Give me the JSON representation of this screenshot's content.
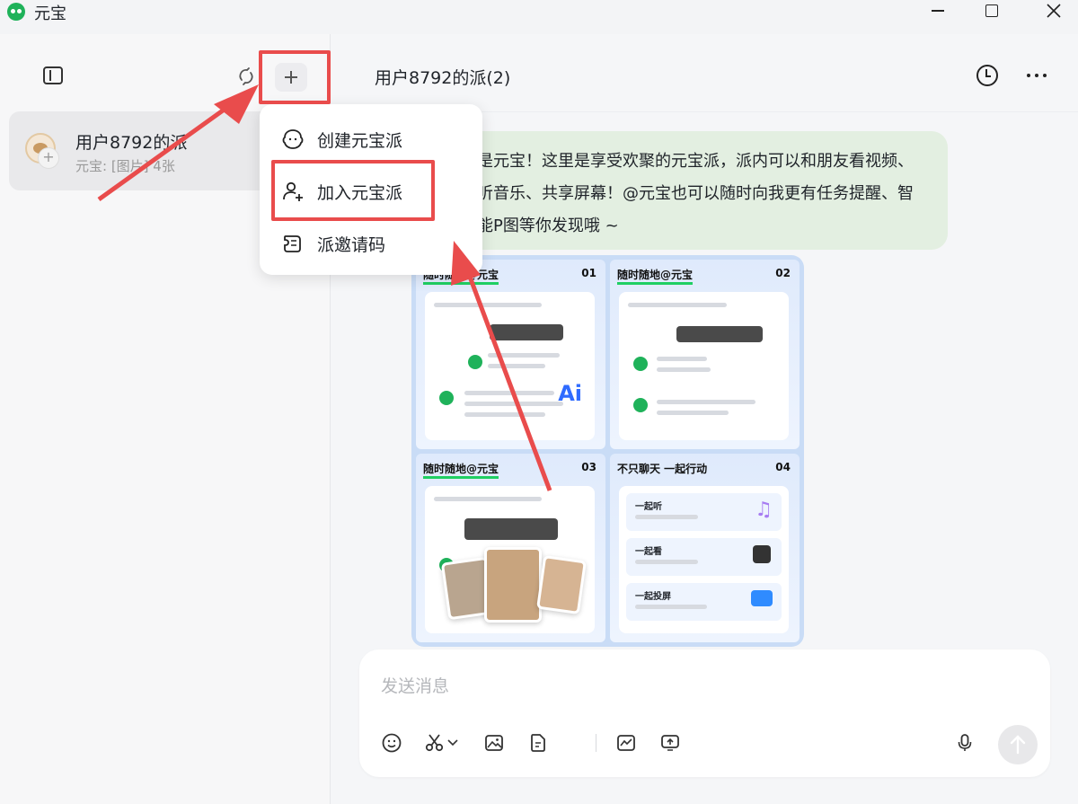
{
  "window": {
    "title": "元宝"
  },
  "sidebar": {
    "conversation": {
      "title": "用户8792的派",
      "subtitle": "元宝: [图片] 4张",
      "avatar_badge": "+"
    }
  },
  "chat": {
    "title": "用户8792的派(2)",
    "message": "是元宝！这里是享受欢聚的元宝派，派内可以和朋友看视频、听音乐、共享屏幕！@元宝也可以随时向我更有任务提醒、智能P图等你发现哦 ~",
    "image_cards": [
      {
        "title": "随时随地@元宝",
        "index": "01"
      },
      {
        "title": "随时随地@元宝",
        "index": "02"
      },
      {
        "title": "随时随地@元宝",
        "index": "03"
      },
      {
        "title": "不只聊天 一起行动",
        "index": "04"
      }
    ],
    "card4_rows": [
      "一起听",
      "一起看",
      "一起投屏"
    ],
    "card1_ai": "Ai"
  },
  "composer": {
    "placeholder": "发送消息"
  },
  "menu": {
    "items": [
      {
        "label": "创建元宝派",
        "icon": "create-group-icon"
      },
      {
        "label": "加入元宝派",
        "icon": "join-group-icon"
      },
      {
        "label": "派邀请码",
        "icon": "invite-code-icon"
      }
    ]
  },
  "annotation_color": "#e94c4c",
  "brand_color": "#1fb25a"
}
